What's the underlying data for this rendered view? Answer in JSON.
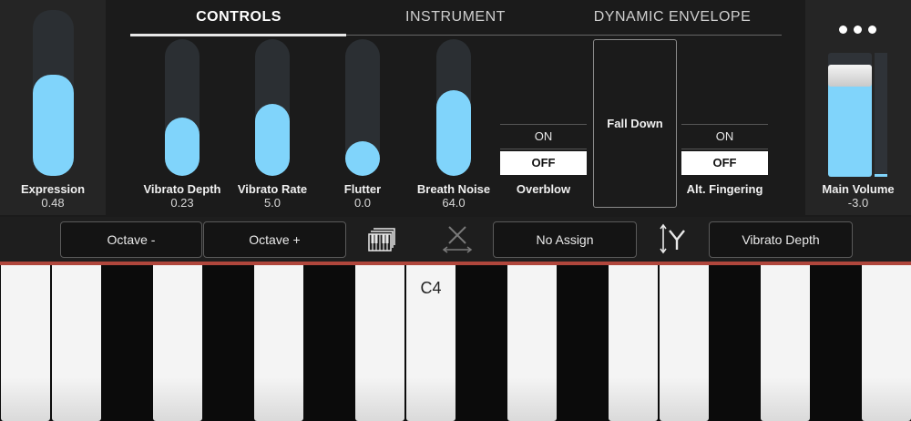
{
  "tabs": [
    {
      "label": "CONTROLS",
      "active": true
    },
    {
      "label": "INSTRUMENT",
      "active": false
    },
    {
      "label": "DYNAMIC ENVELOPE",
      "active": false
    }
  ],
  "expression": {
    "label": "Expression",
    "value": "0.48",
    "level": 0.48
  },
  "sliders": [
    {
      "label": "Vibrato Depth",
      "value": "0.23",
      "level": 0.23
    },
    {
      "label": "Vibrato Rate",
      "value": "5.0",
      "level": 0.37
    },
    {
      "label": "Flutter",
      "value": "0.0",
      "level": 0.0
    },
    {
      "label": "Breath Noise",
      "value": "64.0",
      "level": 0.5
    }
  ],
  "overblow": {
    "label": "Overblow",
    "on_label": "ON",
    "off_label": "OFF",
    "state": "OFF"
  },
  "fall_down": {
    "label": "Fall Down"
  },
  "alt_fingering": {
    "label": "Alt. Fingering",
    "on_label": "ON",
    "off_label": "OFF",
    "state": "OFF"
  },
  "main_volume": {
    "label": "Main Volume",
    "value": "-3.0",
    "level": 0.82
  },
  "toolbar": {
    "octave_minus": "Octave -",
    "octave_plus": "Octave +",
    "x_assign": "No Assign",
    "y_assign": "Vibrato Depth"
  },
  "keyboard": {
    "c4_label": "C4"
  },
  "colors": {
    "accent": "#80d4fb",
    "divider": "#b0463c"
  }
}
